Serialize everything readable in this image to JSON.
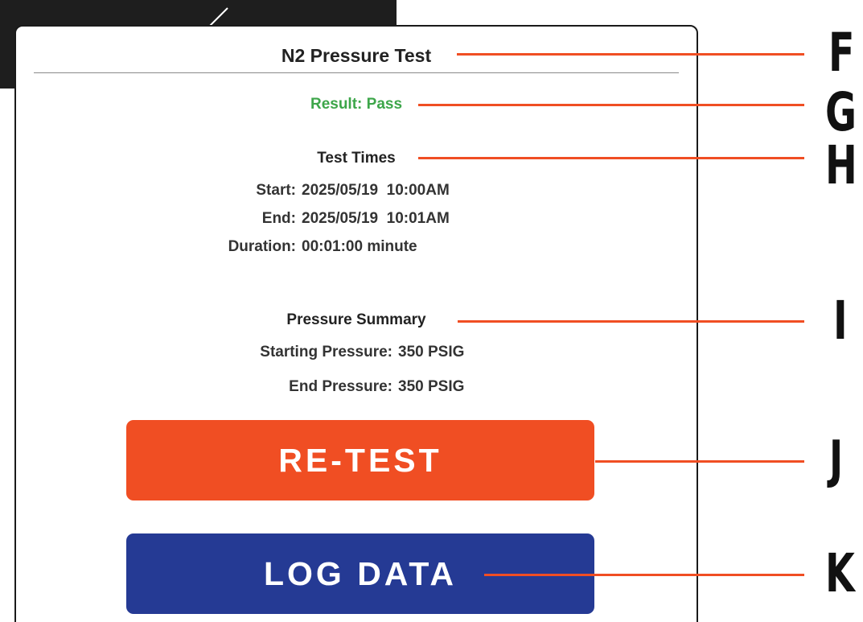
{
  "colors": {
    "accent_orange": "#f04e23",
    "accent_blue": "#253a94",
    "pass_green": "#3da64a",
    "callout_line": "#f04e23"
  },
  "dialog": {
    "title": "N2 Pressure Test",
    "result": "Result: Pass",
    "test_times": {
      "heading": "Test Times",
      "rows": [
        {
          "label": "Start:",
          "value": "2025/05/19  10:00AM"
        },
        {
          "label": "End:",
          "value": "2025/05/19  10:01AM"
        },
        {
          "label": "Duration:",
          "value": "00:01:00 minute"
        }
      ]
    },
    "pressure_summary": {
      "heading": "Pressure Summary",
      "rows": [
        {
          "label": "Starting Pressure:",
          "value": "350 PSIG"
        },
        {
          "label": "End Pressure:",
          "value": "350 PSIG"
        }
      ]
    },
    "buttons": {
      "retest_label": "RE-TEST",
      "log_data_label": "LOG DATA"
    }
  },
  "callouts": [
    "F",
    "G",
    "H",
    "I",
    "J",
    "K"
  ]
}
